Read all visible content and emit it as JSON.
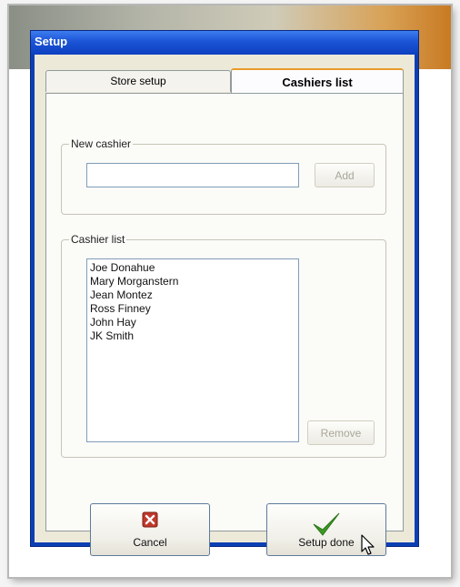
{
  "window": {
    "title": "Setup"
  },
  "tabs": [
    {
      "label": "Store setup",
      "active": false
    },
    {
      "label": "Cashiers list",
      "active": true
    }
  ],
  "new_cashier": {
    "legend": "New cashier",
    "input_value": "",
    "add_label": "Add"
  },
  "cashier_list": {
    "legend": "Cashier list",
    "items": [
      "Joe Donahue",
      "Mary Morganstern",
      "Jean Montez",
      "Ross Finney",
      "John Hay",
      "JK Smith"
    ],
    "remove_label": "Remove"
  },
  "actions": {
    "cancel_label": "Cancel",
    "done_label": "Setup done"
  },
  "colors": {
    "titlebar": "#1b54d6",
    "cancel_icon": "#c0392b",
    "check_icon": "#3a9a22"
  }
}
